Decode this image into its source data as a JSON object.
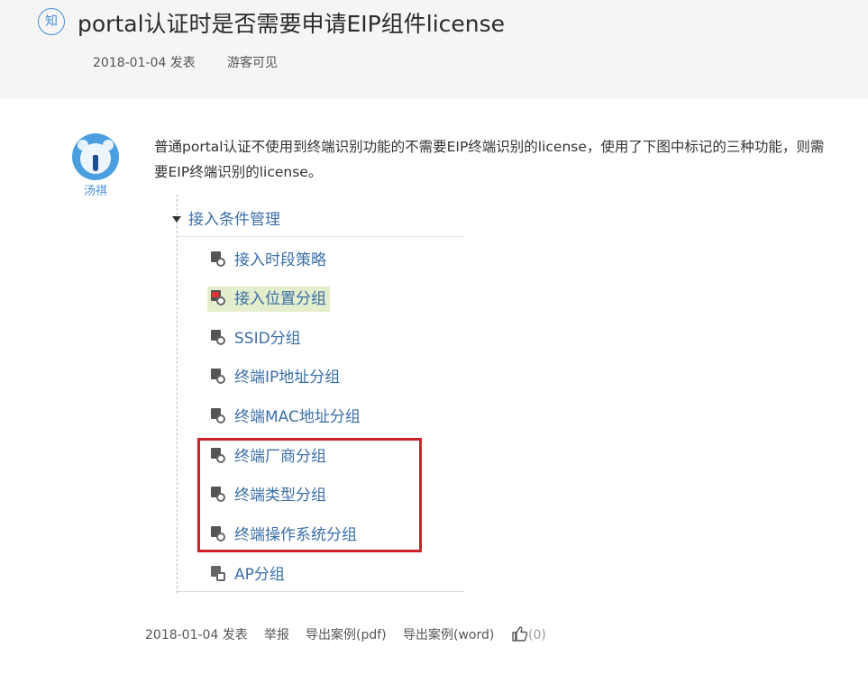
{
  "header": {
    "badge": "知",
    "title": "portal认证时是否需要申请EIP组件license",
    "date": "2018-01-04 发表",
    "visibility": "游客可见"
  },
  "answer": {
    "author": "汤祺",
    "text": "普通portal认证不使用到终端识别功能的不需要EIP终端识别的license，使用了下图中标记的三种功能，则需要EIP终端识别的license。"
  },
  "tree": {
    "root": "接入条件管理",
    "items": [
      {
        "label": "接入时段策略"
      },
      {
        "label": "接入位置分组"
      },
      {
        "label": "SSID分组"
      },
      {
        "label": "终端IP地址分组"
      },
      {
        "label": "终端MAC地址分组"
      },
      {
        "label": "终端厂商分组"
      },
      {
        "label": "终端类型分组"
      },
      {
        "label": "终端操作系统分组"
      },
      {
        "label": "AP分组"
      }
    ],
    "selected_index": 1,
    "highlighted_items": [
      "终端厂商分组",
      "终端类型分组",
      "终端操作系统分组"
    ],
    "highlight_color": "#d0202a"
  },
  "footer": {
    "date": "2018-01-04 发表",
    "report": "举报",
    "export_pdf": "导出案例(pdf)",
    "export_word": "导出案例(word)",
    "like_count": "(0)"
  },
  "icons": [
    "knowledge-badge-icon",
    "bear-avatar-icon",
    "caret-down-icon",
    "thumbs-up-icon"
  ],
  "colors": {
    "accent": "#4a90d9",
    "tree_link": "#3b6fa8",
    "selected_bg": "#e4edcc"
  }
}
